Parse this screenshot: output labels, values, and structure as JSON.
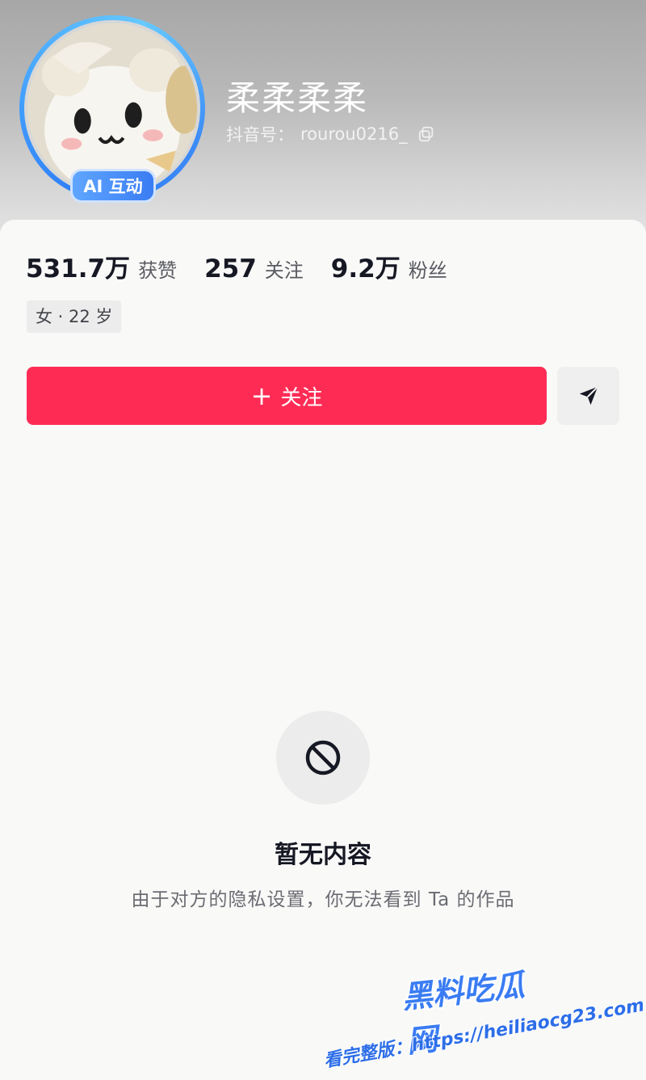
{
  "profile": {
    "name": "柔柔柔柔",
    "douyin_id_label": "抖音号：",
    "douyin_id": "rourou0216_",
    "avatar_badge": "AI 互动",
    "ring_color": "#3d8cf6"
  },
  "stats": [
    {
      "value": "531.7万",
      "label": "获赞"
    },
    {
      "value": "257",
      "label": "关注"
    },
    {
      "value": "9.2万",
      "label": "粉丝"
    }
  ],
  "tag": "女 · 22 岁",
  "actions": {
    "follow_plus": "+",
    "follow_label": "关注",
    "follow_color": "#fe2c55",
    "share_icon": "send-icon"
  },
  "empty_state": {
    "icon": "forbidden-icon",
    "title": "暂无内容",
    "description": "由于对方的隐私设置，你无法看到 Ta 的作品"
  },
  "watermark": {
    "logo": "黑料吃瓜网",
    "url_text": "看完整版：https://heiliaocg23.com"
  }
}
